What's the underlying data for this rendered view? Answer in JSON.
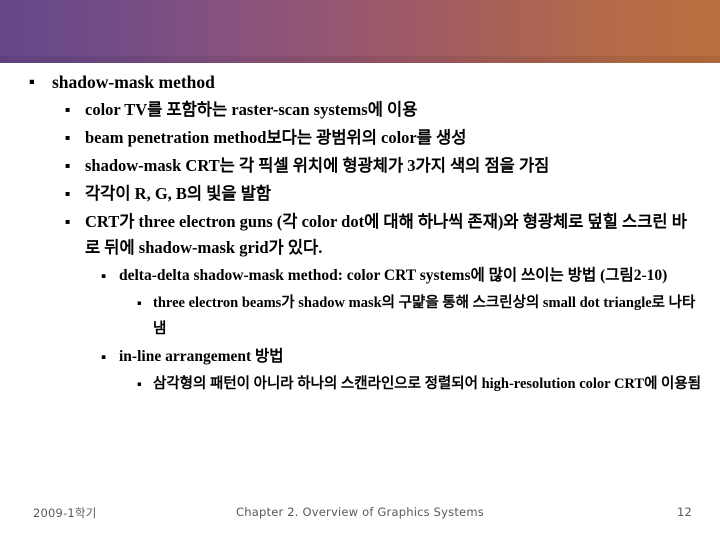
{
  "header": {
    "gradient_start": "#664688",
    "gradient_mid": "#96566f",
    "gradient_end": "#ba703e"
  },
  "bullet_glyph": "▪",
  "content": {
    "bullets": [
      {
        "level": 1,
        "text": "shadow-mask method"
      },
      {
        "level": 2,
        "text": "color TV를 포함하는 raster-scan systems에 이용"
      },
      {
        "level": 2,
        "text": "beam penetration method보다는 광범위의 color를 생성"
      },
      {
        "level": 2,
        "text": "shadow-mask CRT는 각 픽셀 위치에 형광체가 3가지 색의 점을 가짐"
      },
      {
        "level": 2,
        "text": "각각이 R, G, B의 빛을 발함"
      },
      {
        "level": 2,
        "text": "CRT가 three electron guns (각 color dot에 대해 하나씩 존재)와 형광체로 덮힐 스크린 바로 뒤에 shadow-mask grid가 있다."
      },
      {
        "level": 3,
        "text": "delta-delta shadow-mask method: color CRT systems에 많이 쓰이는 방법 (그림2-10)"
      },
      {
        "level": 4,
        "text": "three electron beams가 shadow mask의 구먍을 통해 스크린상의 small dot triangle로 나타냄"
      },
      {
        "level": 3,
        "text": "in-line arrangement 방법"
      },
      {
        "level": 4,
        "text": "삼각형의 패턴이 아니라 하나의 스캔라인으로 정렬되어 high-resolution color CRT에 이용됨"
      }
    ]
  },
  "footer": {
    "left": "2009-1학기",
    "center": "Chapter 2. Overview of Graphics Systems",
    "page_number": "12",
    "text_color": "#5a5a5a"
  }
}
